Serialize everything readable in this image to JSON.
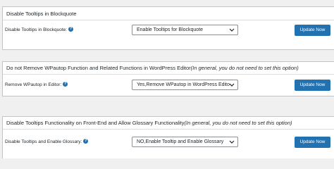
{
  "sections": [
    {
      "title": "Disable Tooltips in Blockquote",
      "note": "",
      "field_label": "Disable Tooltips in Blockquote:",
      "selected_option": "Enable Tooltips for Blockquote",
      "button_label": "Update Now"
    },
    {
      "title": "Do not Remove WPautop Function and Related Functions in WordPress Editor",
      "note": "(In general, you do not need to set this option)",
      "field_label": "Remove WPautop in Editor:",
      "selected_option": "Yes,Remove WPautop in WordPress Edito",
      "button_label": "Update Now"
    },
    {
      "title": "Disable Tooltips Functionality on Front-End and Allow Glossary Functionality",
      "note": "(In general, you do not need to set this option)",
      "field_label": "Disable Tooltips and Enable Glossary:",
      "selected_option": "NO,Enable Tooltip and Enable Glossary",
      "button_label": "Update Now"
    }
  ],
  "help_icon_glyph": "?",
  "colors": {
    "background": "#f0f0f1",
    "panel": "#ffffff",
    "button": "#2271b1",
    "button_text": "#ffffff",
    "border": "#c3c4c7"
  }
}
